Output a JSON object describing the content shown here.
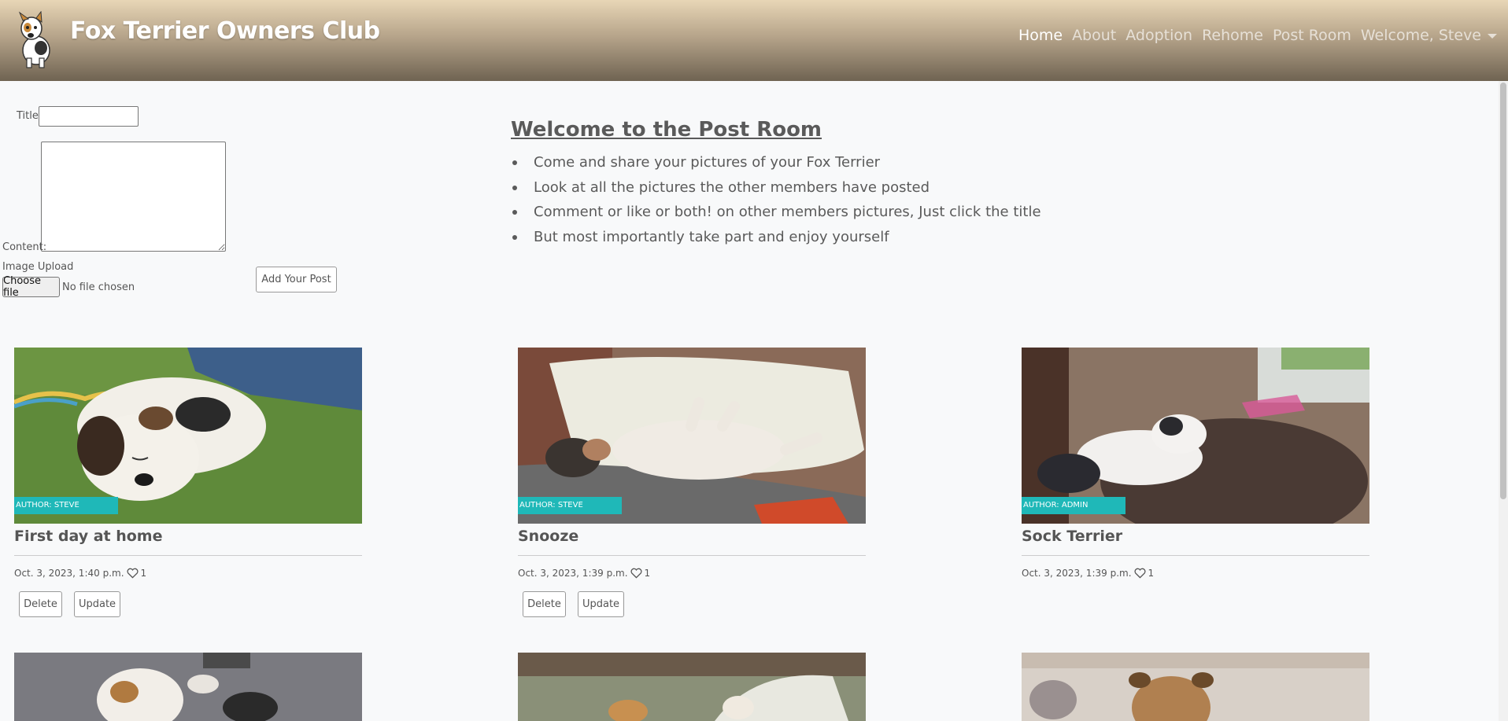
{
  "brand": {
    "name": "Fox Terrier Owners Club",
    "logo_icon": "fox-terrier-logo-icon"
  },
  "nav": {
    "items": [
      {
        "label": "Home",
        "active": true
      },
      {
        "label": "About",
        "active": false
      },
      {
        "label": "Adoption",
        "active": false
      },
      {
        "label": "Rehome",
        "active": false
      },
      {
        "label": "Post Room",
        "active": false
      },
      {
        "label": "Welcome, Steve",
        "active": false,
        "dropdown": true
      }
    ]
  },
  "form": {
    "title_label": "Title:",
    "title_value": "",
    "content_label": "Content:",
    "content_value": "",
    "image_label": "Image Upload",
    "file_button": "Choose file",
    "file_status": "No file chosen",
    "submit_label": "Add Your Post"
  },
  "welcome": {
    "title": "Welcome to the Post Room",
    "bullets": [
      "Come and share your pictures of your Fox Terrier",
      "Look at all the pictures the other members have posted",
      "Comment or like or both! on other members pictures, Just click the title",
      "But most importantly take part and enjoy yourself"
    ]
  },
  "posts": [
    {
      "author": "Author: Steve",
      "title": "First day at home",
      "date": "Oct. 3, 2023, 1:40 p.m.",
      "likes": "1",
      "delete": "Delete",
      "update": "Update",
      "has_actions": true,
      "image": "puppy-on-grass"
    },
    {
      "author": "Author: Steve",
      "title": "Snooze",
      "date": "Oct. 3, 2023, 1:39 p.m.",
      "likes": "1",
      "delete": "Delete",
      "update": "Update",
      "has_actions": true,
      "image": "dog-sleeping-on-cushion"
    },
    {
      "author": "Author: admin",
      "title": "Sock Terrier",
      "date": "Oct. 3, 2023, 1:39 p.m.",
      "likes": "1",
      "has_actions": false,
      "image": "dog-on-beanbag"
    }
  ],
  "colors": {
    "badge": "#1fb8b8",
    "nav_top": "#e8d6b6",
    "nav_bottom": "#6f6352"
  }
}
